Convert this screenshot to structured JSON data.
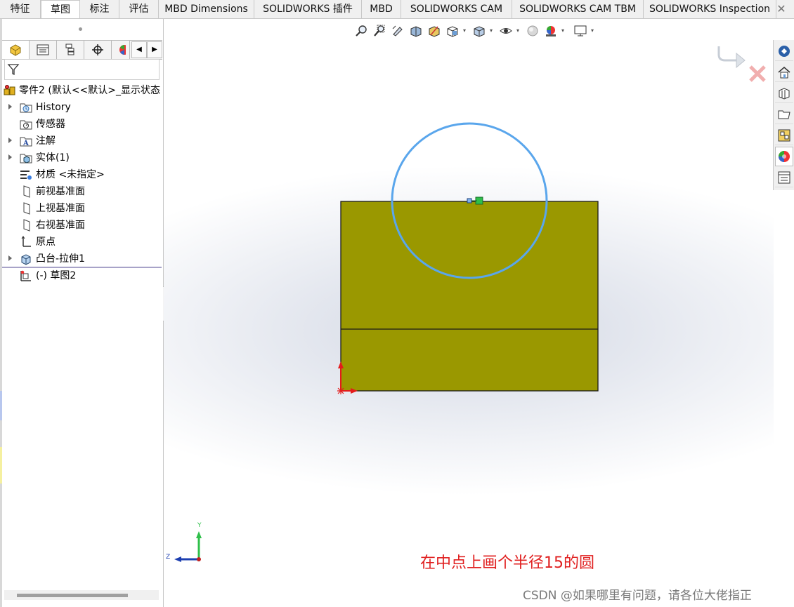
{
  "tabs": [
    {
      "label": "特征",
      "active": false
    },
    {
      "label": "草图",
      "active": true
    },
    {
      "label": "标注",
      "active": false
    },
    {
      "label": "评估",
      "active": false
    },
    {
      "label": "MBD Dimensions",
      "active": false
    },
    {
      "label": "SOLIDWORKS 插件",
      "active": false
    },
    {
      "label": "MBD",
      "active": false
    },
    {
      "label": "SOLIDWORKS CAM",
      "active": false
    },
    {
      "label": "SOLIDWORKS CAM TBM",
      "active": false
    },
    {
      "label": "SOLIDWORKS Inspection",
      "active": false
    }
  ],
  "tab_close": "✕",
  "feature_tree": {
    "root": "零件2  (默认<<默认>_显示状态",
    "items": [
      {
        "label": "History",
        "icon": "history-folder-icon",
        "expandable": true
      },
      {
        "label": "传感器",
        "icon": "sensors-folder-icon",
        "expandable": false
      },
      {
        "label": "注解",
        "icon": "annotations-folder-icon",
        "expandable": true
      },
      {
        "label": "实体(1)",
        "icon": "solid-bodies-folder-icon",
        "expandable": true
      },
      {
        "label": "材质 <未指定>",
        "icon": "material-icon",
        "expandable": false
      },
      {
        "label": "前视基准面",
        "icon": "plane-icon",
        "expandable": false
      },
      {
        "label": "上视基准面",
        "icon": "plane-icon",
        "expandable": false
      },
      {
        "label": "右视基准面",
        "icon": "plane-icon",
        "expandable": false
      },
      {
        "label": "原点",
        "icon": "origin-icon",
        "expandable": false
      },
      {
        "label": "凸台-拉伸1",
        "icon": "boss-extrude-icon",
        "expandable": true
      },
      {
        "label": "(-) 草图2",
        "icon": "sketch-icon",
        "expandable": false
      }
    ]
  },
  "triad_labels": {
    "y": "Y",
    "z": "Z"
  },
  "annotation_text": "在中点上画个半径15的圆",
  "watermark_text": "CSDN @如果哪里有问题，请各位大佬指正",
  "colors": {
    "part_fill": "#9a9800",
    "sketch_circle": "#5aa6ec",
    "annotation": "#e02020",
    "midpoint_marker": "#2fbf4a"
  }
}
